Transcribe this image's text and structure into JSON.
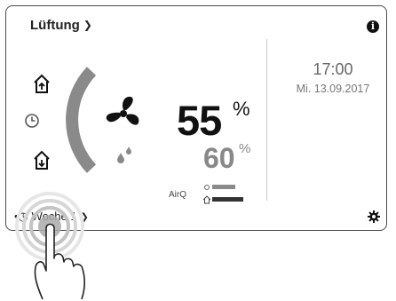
{
  "header": {
    "menu_label": "Lüftung",
    "info_icon": "i"
  },
  "clock": {
    "time": "17:00",
    "date": "Mi. 13.09.2017"
  },
  "ventilation": {
    "fan_level": "55",
    "fan_unit": "%",
    "humidity": "60",
    "humidity_unit": "%"
  },
  "air_quality": {
    "label": "AirQ"
  },
  "footer": {
    "schedule_label": "Woche 1"
  },
  "icons": {
    "house_up": "house-up-arrow-icon",
    "clock": "clock-icon",
    "house_down": "house-down-arrow-icon",
    "fan": "fan-icon",
    "humidity": "humidity-drops-icon",
    "settings": "gear-icon",
    "schedule": "schedule-clock-icon"
  },
  "colors": {
    "accent_gray": "#8a8a8a",
    "text_dark": "#1a1a1a"
  }
}
